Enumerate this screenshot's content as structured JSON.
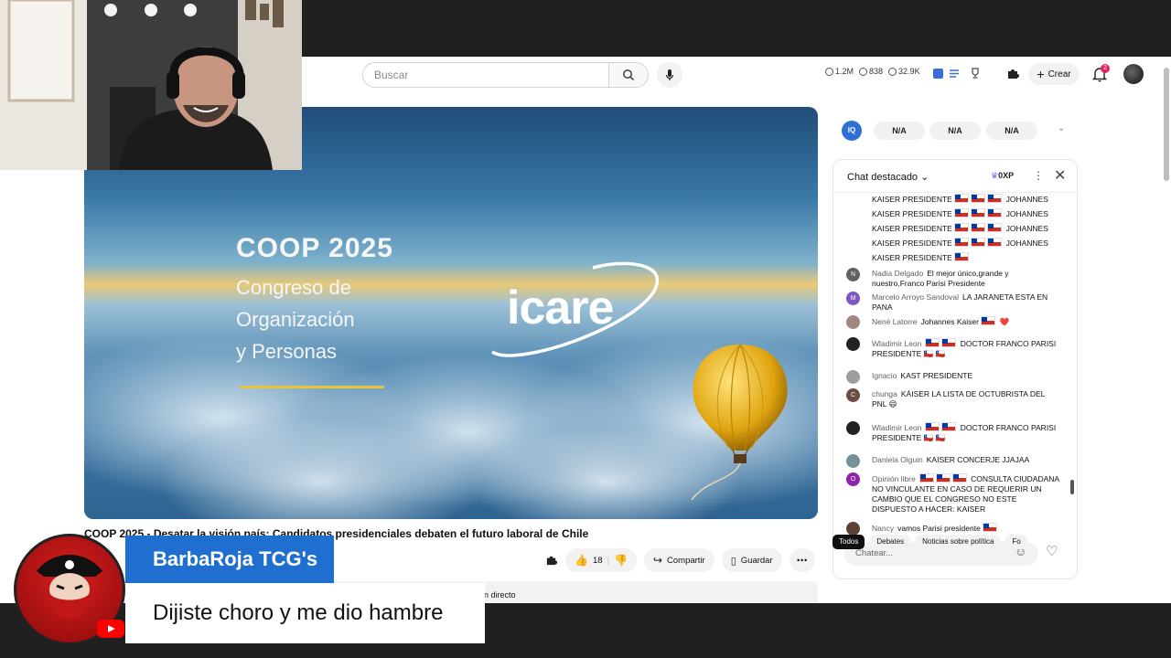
{
  "search": {
    "placeholder": "Buscar"
  },
  "stats": {
    "views": "1.2M",
    "watching": "838",
    "likes": "32.9K"
  },
  "header": {
    "create_label": "Crear",
    "notifications_count": "2"
  },
  "video": {
    "slide_title": "COOP 2025",
    "slide_subtitle_lines": [
      "Congreso de",
      "Organización",
      "y Personas"
    ],
    "slide_brand": "icare",
    "title": "COOP 2025 - Desatar la visión país: Candidatos presidenciales debaten el futuro laboral de Chile",
    "likes": "18",
    "share_label": "Compartir",
    "save_label": "Guardar",
    "desc_fragment": "en directo"
  },
  "extension": {
    "pills": [
      "N/A",
      "N/A",
      "N/A"
    ],
    "logo": "IQ"
  },
  "chat": {
    "title": "Chat destacado",
    "xp": "0XP",
    "input_placeholder": "Chatear...",
    "messages": [
      {
        "author": "",
        "avatar": "",
        "color": "",
        "text": "KAISER PRESIDENTE",
        "flags": 3,
        "after": "JOHANNES"
      },
      {
        "author": "",
        "avatar": "",
        "color": "",
        "text": "KAISER PRESIDENTE",
        "flags": 3,
        "after": "JOHANNES"
      },
      {
        "author": "",
        "avatar": "",
        "color": "",
        "text": "KAISER PRESIDENTE",
        "flags": 3,
        "after": "JOHANNES"
      },
      {
        "author": "",
        "avatar": "",
        "color": "",
        "text": "KAISER PRESIDENTE",
        "flags": 3,
        "after": "JOHANNES"
      },
      {
        "author": "",
        "avatar": "",
        "color": "",
        "text": "KAISER PRESIDENTE",
        "flags": 1,
        "after": ""
      },
      {
        "author": "Nadia Delgado",
        "avatar": "N",
        "color": "#616161",
        "text": "El mejor único,grande y nuestro,Franco Parisi Presidente",
        "flags": 0,
        "after": ""
      },
      {
        "author": "Marcelo Arroyo Sandoval",
        "avatar": "M",
        "color": "#7e57c2",
        "text": "LA JARANETA ESTA EN PANA",
        "flags": 0,
        "after": ""
      },
      {
        "author": "Nené Latorre",
        "avatar": "",
        "color": "#a1887f",
        "text": "Johannes Kaiser",
        "flags": 1,
        "after": "❤️"
      },
      {
        "author": "Wladimir Leon",
        "avatar": "",
        "color": "#222222",
        "text": "",
        "flags": 2,
        "after": "DOCTOR FRANCO PARISI PRESIDENTE 🇨🇱 🇨🇱"
      },
      {
        "author": "Ignacio",
        "avatar": "",
        "color": "#9e9e9e",
        "text": "KAST PRESIDENTE",
        "flags": 0,
        "after": ""
      },
      {
        "author": "chunga",
        "avatar": "C",
        "color": "#6d4c41",
        "text": "KÁISER LA LISTA DE OCTUBRISTA DEL PNL 😄",
        "flags": 0,
        "after": ""
      },
      {
        "author": "Wladimir Leon",
        "avatar": "",
        "color": "#222222",
        "text": "",
        "flags": 2,
        "after": "DOCTOR FRANCO PARISI PRESIDENTE 🇨🇱 🇨🇱"
      },
      {
        "author": "Daniela Olguin",
        "avatar": "",
        "color": "#78909c",
        "text": "KAISER CONCERJE JJAJAA",
        "flags": 0,
        "after": ""
      },
      {
        "author": "Opinión libre",
        "avatar": "O",
        "color": "#8e24aa",
        "text": "",
        "flags": 3,
        "after": "CONSULTA CIUDADANA NO VINCULANTE EN CASO DE REQUERIR UN CAMBIO QUE EL CONGRESO NO ESTE DISPUESTO A HACER: KAISER"
      },
      {
        "author": "Nancy",
        "avatar": "",
        "color": "#5d4037",
        "text": "vamos Parisi presidente",
        "flags": 1,
        "after": ""
      }
    ]
  },
  "chips": [
    "Todos",
    "Debates",
    "Noticias sobre política",
    "Fo"
  ],
  "overlay": {
    "channel_name": "BarbaRoja TCG's",
    "quote": "Dijiste choro y me dio hambre"
  },
  "colors": {
    "accent_blue": "#1f6fd1",
    "chat_flag_red": "#d52b1e",
    "youtube_red": "#ff0000"
  }
}
